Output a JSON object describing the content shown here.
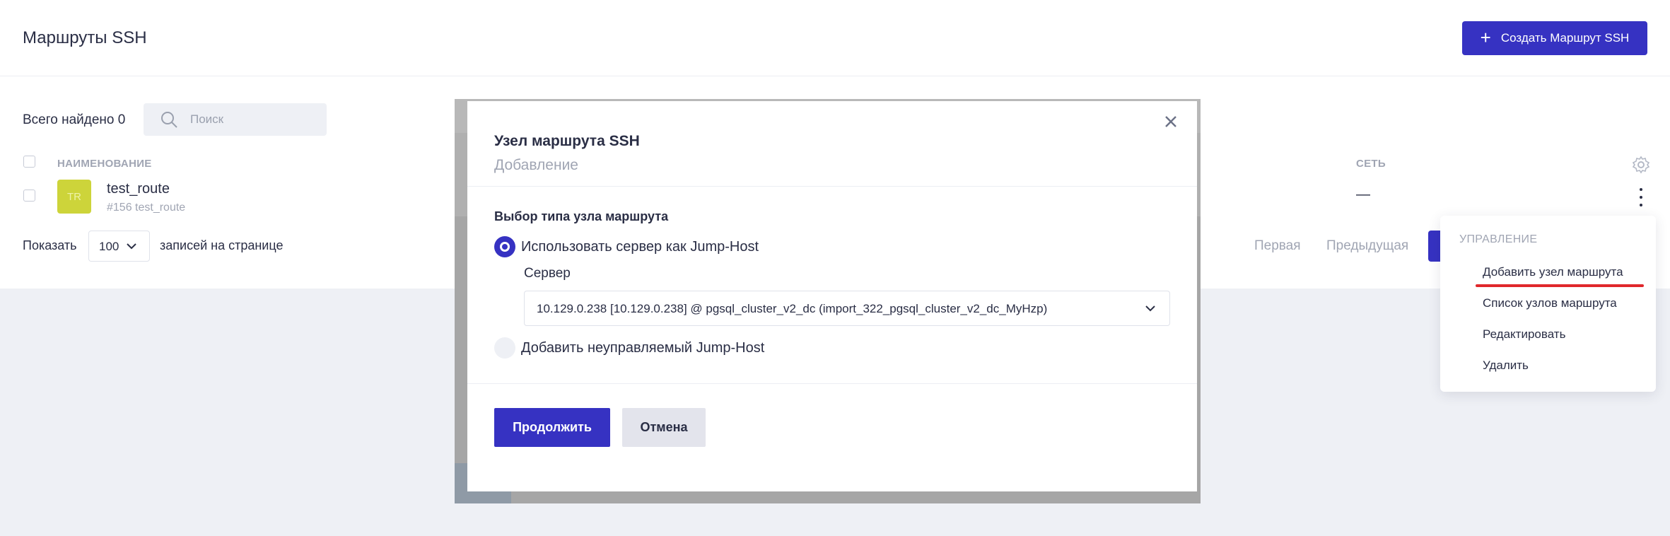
{
  "header": {
    "title": "Маршруты SSH",
    "create_button": "Создать Маршрут SSH"
  },
  "toolbar": {
    "total_label": "Всего найдено 0",
    "search_placeholder": "Поиск"
  },
  "table": {
    "columns": {
      "name": "НАИМЕНОВАНИЕ",
      "network": "СЕТЬ"
    },
    "rows": [
      {
        "avatar": "TR",
        "name": "test_route",
        "id": "#156 test_route",
        "network": "—"
      }
    ]
  },
  "pagination": {
    "show_label": "Показать",
    "per_page": "100",
    "per_page_suffix": "записей на странице",
    "first": "Первая",
    "previous": "Предыдущая"
  },
  "modal": {
    "title": "Узел маршрута SSH",
    "subtitle": "Добавление",
    "section_title": "Выбор типа узла маршрута",
    "option_jump_host": "Использовать сервер как Jump-Host",
    "server_label": "Сервер",
    "server_value": "10.129.0.238 [10.129.0.238] @ pgsql_cluster_v2_dc (import_322_pgsql_cluster_v2_dc_MyHzp)",
    "option_unmanaged": "Добавить неуправляемый Jump-Host",
    "continue_button": "Продолжить",
    "cancel_button": "Отмена"
  },
  "context_menu": {
    "heading": "УПРАВЛЕНИЕ",
    "items": [
      "Добавить узел маршрута",
      "Список узлов маршрута",
      "Редактировать",
      "Удалить"
    ]
  },
  "colors": {
    "accent": "#3632c2",
    "avatar": "#cdd43a",
    "highlight": "#e0282c"
  }
}
